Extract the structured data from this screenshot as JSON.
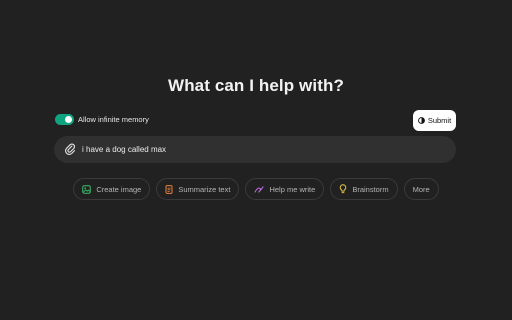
{
  "heading": "What can I help with?",
  "memory_toggle": {
    "label": "Allow infinite memory",
    "enabled": true
  },
  "submit": {
    "label": "Submit",
    "icon": "submit-icon"
  },
  "prompt": {
    "value": "i have a dog called max",
    "attach_icon": "paperclip-icon"
  },
  "suggestions": [
    {
      "label": "Create image",
      "icon": "image-icon",
      "color": "#3dbd6b"
    },
    {
      "label": "Summarize text",
      "icon": "document-icon",
      "color": "#e8843d"
    },
    {
      "label": "Help me write",
      "icon": "pen-icon",
      "color": "#c46fe6"
    },
    {
      "label": "Brainstorm",
      "icon": "lightbulb-icon",
      "color": "#e2c341"
    },
    {
      "label": "More",
      "icon": "",
      "color": ""
    }
  ],
  "colors": {
    "background": "#212121",
    "input_background": "#303030",
    "toggle_on": "#10a37f"
  }
}
